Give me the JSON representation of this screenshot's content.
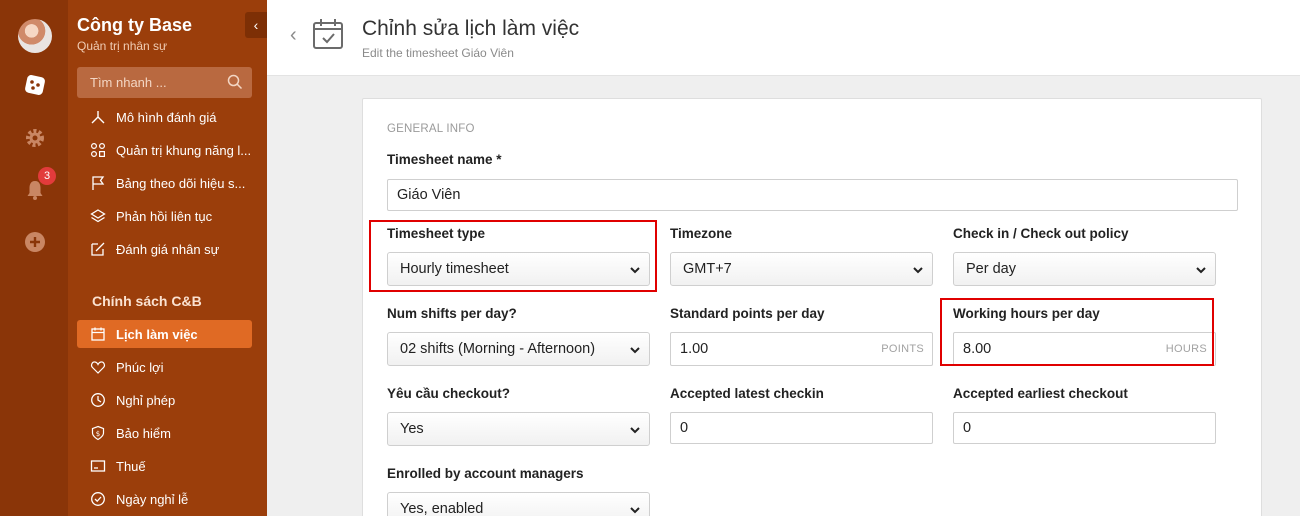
{
  "sidebar": {
    "company_name": "Công ty Base",
    "company_sub": "Quản trị nhân sự",
    "collapse_icon": "chevron-left-icon",
    "search_placeholder": "Tìm nhanh ...",
    "items": [
      {
        "label": "Mô hình đánh giá",
        "icon": "tripod-icon"
      },
      {
        "label": "Quản trị khung năng l...",
        "icon": "grid-icon"
      },
      {
        "label": "Bảng theo dõi hiệu s...",
        "icon": "flag-icon"
      },
      {
        "label": "Phản hồi liên tục",
        "icon": "layers-icon"
      },
      {
        "label": "Đánh giá nhân sự",
        "icon": "edit-icon"
      }
    ],
    "section_title": "Chính sách C&B",
    "section_items": [
      {
        "label": "Lịch làm việc",
        "icon": "calendar-icon",
        "active": true
      },
      {
        "label": "Phúc lợi",
        "icon": "heart-icon"
      },
      {
        "label": "Nghỉ phép",
        "icon": "clock-icon"
      },
      {
        "label": "Bảo hiểm",
        "icon": "shield-icon"
      },
      {
        "label": "Thuế",
        "icon": "card-icon"
      },
      {
        "label": "Ngày nghỉ lễ",
        "icon": "check-circle-icon"
      }
    ]
  },
  "rail": {
    "notification_count": "3",
    "icons": [
      "avatar",
      "dice-icon",
      "gear-icon",
      "bell-icon",
      "plus-circle-icon"
    ]
  },
  "header": {
    "title": "Chỉnh sửa lịch làm việc",
    "subtitle": "Edit the timesheet Giáo Viên"
  },
  "form": {
    "section": "GENERAL INFO",
    "timesheet_name_label": "Timesheet name *",
    "timesheet_name_value": "Giáo Viên",
    "timesheet_type_label": "Timesheet type",
    "timesheet_type_value": "Hourly timesheet",
    "timezone_label": "Timezone",
    "timezone_value": "GMT+7",
    "checkin_policy_label": "Check in / Check out policy",
    "checkin_policy_value": "Per day",
    "num_shifts_label": "Num shifts per day?",
    "num_shifts_value": "02 shifts (Morning - Afternoon)",
    "standard_points_label": "Standard points per day",
    "standard_points_value": "1.00",
    "standard_points_unit": "POINTS",
    "working_hours_label": "Working hours per day",
    "working_hours_value": "8.00",
    "working_hours_unit": "HOURS",
    "checkout_required_label": "Yêu cầu checkout?",
    "checkout_required_value": "Yes",
    "latest_checkin_label": "Accepted latest checkin",
    "latest_checkin_value": "0",
    "earliest_checkout_label": "Accepted earliest checkout",
    "earliest_checkout_value": "0",
    "enrolled_label": "Enrolled by account managers",
    "enrolled_value": "Yes, enabled"
  },
  "colors": {
    "rail": "#8a3508",
    "sidebar": "#9b3e0b",
    "active_item": "#e06a24",
    "highlight": "#e00000"
  }
}
